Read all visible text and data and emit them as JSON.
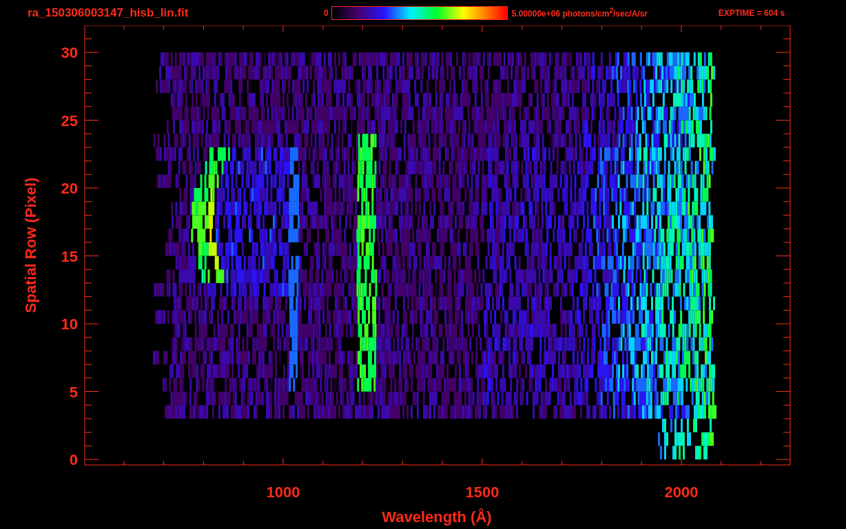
{
  "title": "ra_150306003147_hisb_lin.fit",
  "colorbar": {
    "min_label": "0",
    "max_label": "5.00000e+06 photons/cm$^{2}$/sec/A/sr"
  },
  "exptime": "EXPTIME = 604 s",
  "plot": {
    "xlabel": "Wavelength (Å)",
    "ylabel": "Spatial Row (Pixel)",
    "xticks": [
      "1000",
      "1500",
      "2000"
    ],
    "yticks": [
      "30",
      "25",
      "20",
      "15",
      "10",
      "5",
      "0"
    ]
  }
}
